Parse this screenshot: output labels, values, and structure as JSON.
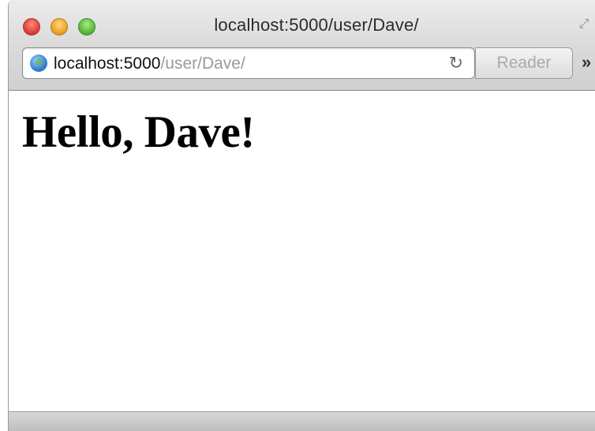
{
  "window": {
    "title": "localhost:5000/user/Dave/"
  },
  "toolbar": {
    "url_host": "localhost:5000",
    "url_path": "/user/Dave/",
    "reload_icon": "↻",
    "reader_label": "Reader",
    "overflow_icon": "»"
  },
  "page": {
    "heading": "Hello, Dave!"
  }
}
